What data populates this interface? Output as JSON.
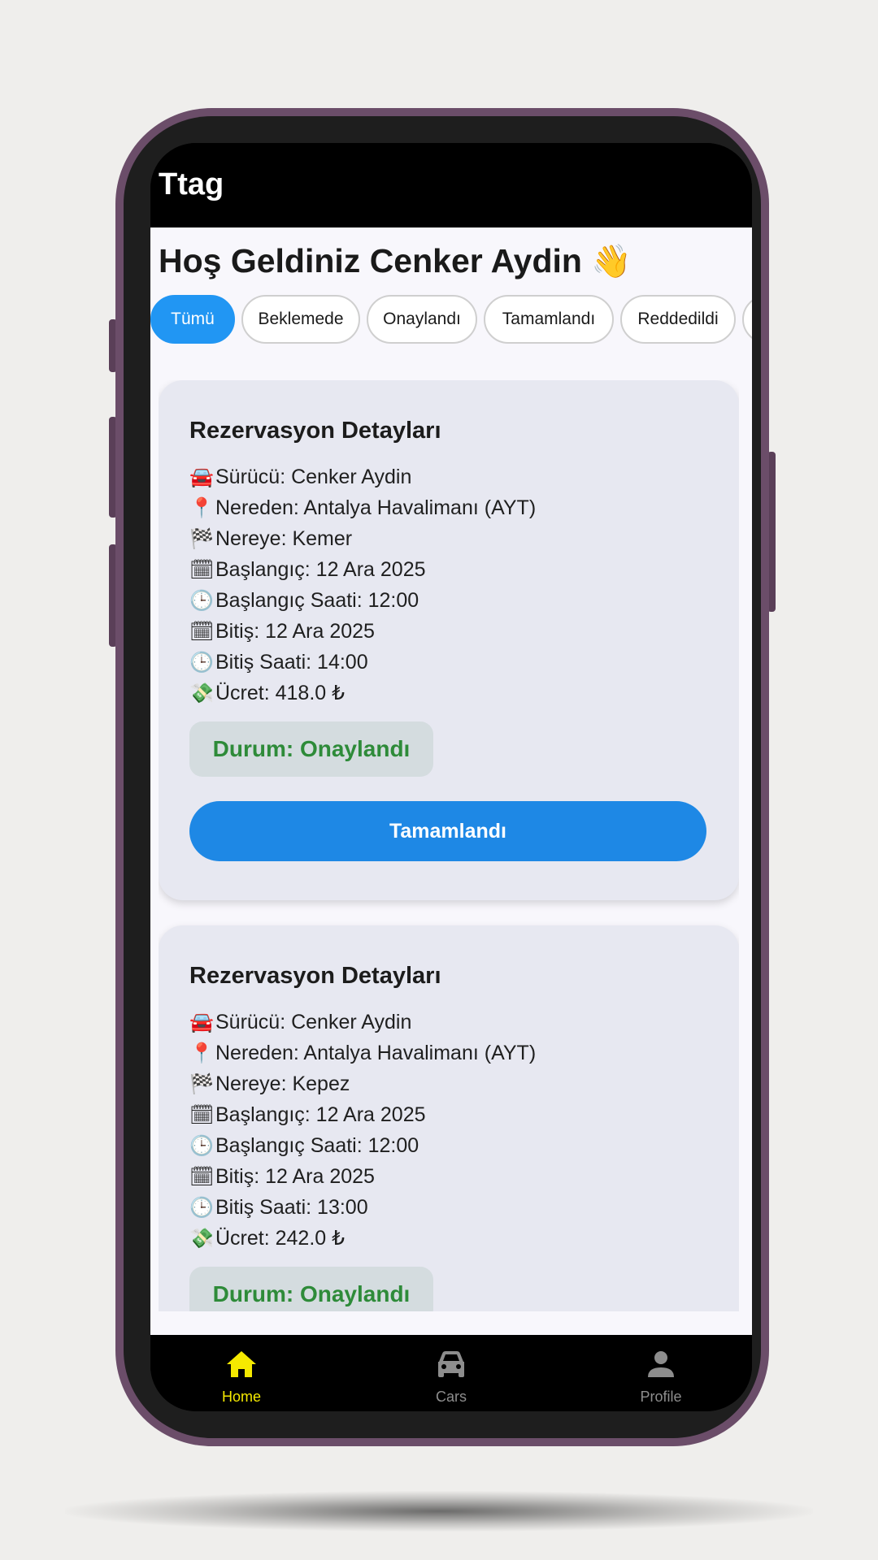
{
  "app": {
    "title": "Ttag"
  },
  "greeting": {
    "text": "Hoş Geldiniz Cenker Aydin",
    "emoji": "👋"
  },
  "filters": [
    {
      "label": "Tümü",
      "active": true
    },
    {
      "label": "Beklemede",
      "active": false
    },
    {
      "label": "Onaylandı",
      "active": false
    },
    {
      "label": "Tamamlandı",
      "active": false
    },
    {
      "label": "Reddedildi",
      "active": false
    }
  ],
  "reservations": [
    {
      "title": "Rezervasyon Detayları",
      "details": [
        {
          "icon": "car-icon",
          "emoji": "🚘",
          "text": "Sürücü: Cenker Aydin"
        },
        {
          "icon": "pin-icon",
          "emoji": "📍",
          "text": "Nereden: Antalya Havalimanı (AYT)"
        },
        {
          "icon": "flag-icon",
          "emoji": "🏁",
          "text": "Nereye: Kemer"
        },
        {
          "icon": "calendar-icon",
          "emoji": "🗓",
          "text": "Başlangıç: 12 Ara 2025"
        },
        {
          "icon": "clock-icon",
          "emoji": "🕒",
          "text": "Başlangıç Saati: 12:00"
        },
        {
          "icon": "calendar-icon",
          "emoji": "🗓",
          "text": "Bitiş: 12 Ara 2025"
        },
        {
          "icon": "clock-icon",
          "emoji": "🕒",
          "text": "Bitiş Saati: 14:00"
        },
        {
          "icon": "money-icon",
          "emoji": "💸",
          "text": "Ücret: 418.0 ₺"
        }
      ],
      "status": "Durum: Onaylandı",
      "action": "Tamamlandı"
    },
    {
      "title": "Rezervasyon Detayları",
      "details": [
        {
          "icon": "car-icon",
          "emoji": "🚘",
          "text": "Sürücü: Cenker Aydin"
        },
        {
          "icon": "pin-icon",
          "emoji": "📍",
          "text": "Nereden: Antalya Havalimanı (AYT)"
        },
        {
          "icon": "flag-icon",
          "emoji": "🏁",
          "text": "Nereye: Kepez"
        },
        {
          "icon": "calendar-icon",
          "emoji": "🗓",
          "text": "Başlangıç: 12 Ara 2025"
        },
        {
          "icon": "clock-icon",
          "emoji": "🕒",
          "text": "Başlangıç Saati: 12:00"
        },
        {
          "icon": "calendar-icon",
          "emoji": "🗓",
          "text": "Bitiş: 12 Ara 2025"
        },
        {
          "icon": "clock-icon",
          "emoji": "🕒",
          "text": "Bitiş Saati: 13:00"
        },
        {
          "icon": "money-icon",
          "emoji": "💸",
          "text": "Ücret: 242.0 ₺"
        }
      ],
      "status": "Durum: Onaylandı"
    }
  ],
  "bottom_nav": [
    {
      "label": "Home",
      "icon": "home-icon",
      "active": true
    },
    {
      "label": "Cars",
      "icon": "car-icon",
      "active": false
    },
    {
      "label": "Profile",
      "icon": "profile-icon",
      "active": false
    }
  ],
  "colors": {
    "accent": "#2196f3",
    "nav_active": "#f5e900",
    "nav_inactive": "#8d8d8d",
    "status_green": "#2e8b39"
  }
}
